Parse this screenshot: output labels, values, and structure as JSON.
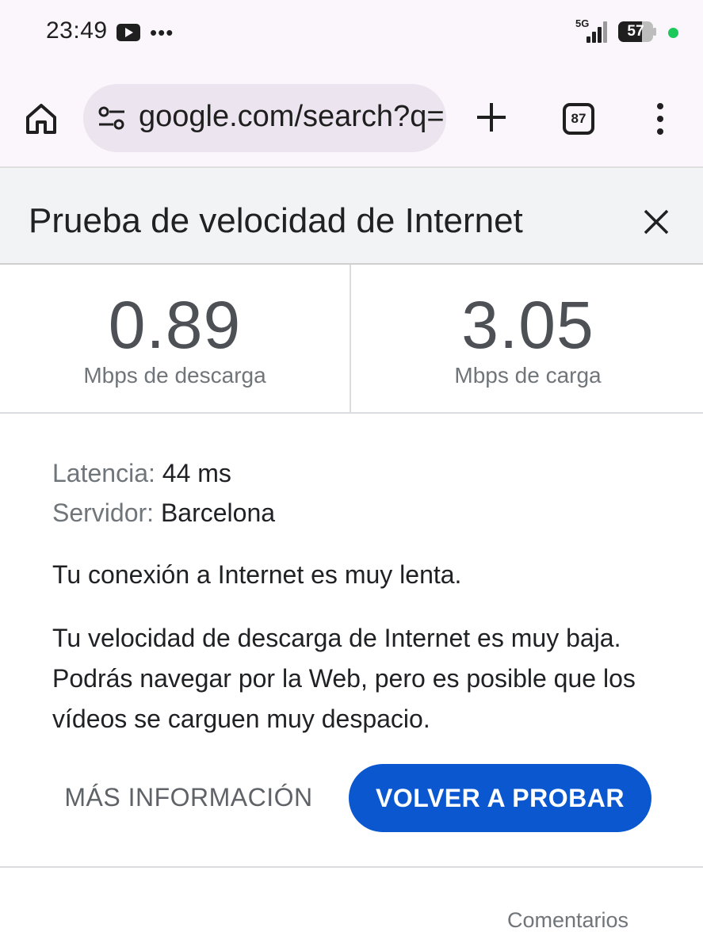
{
  "status_bar": {
    "time": "23:49",
    "network": "5G",
    "battery": "57",
    "icons": [
      "youtube-icon",
      "more-dots-icon",
      "signal-icon",
      "battery-icon",
      "privacy-dot-icon"
    ]
  },
  "browser": {
    "url": "google.com/search?q=",
    "tab_count": "87",
    "icons": [
      "home-icon",
      "site-settings-icon",
      "new-tab-plus-icon",
      "tab-switcher-icon",
      "menu-kebab-icon"
    ]
  },
  "speed_test": {
    "title": "Prueba de velocidad de Internet",
    "download": {
      "value": "0.89",
      "unit": "Mbps de descarga"
    },
    "upload": {
      "value": "3.05",
      "unit": "Mbps de carga"
    },
    "latency": {
      "label": "Latencia:",
      "value": "44 ms"
    },
    "server": {
      "label": "Servidor:",
      "value": "Barcelona"
    },
    "message": "Tu conexión a Internet es muy lenta.",
    "description": "Tu velocidad de descarga de Internet es muy baja. Podrás navegar por la Web, pero es posible que los vídeos se carguen muy despacio.",
    "more_info_label": "MÁS INFORMACIÓN",
    "retry_label": "VOLVER A PROBAR",
    "feedback_label": "Comentarios"
  },
  "colors": {
    "accent": "#0b57d0",
    "status_dot": "#1fc85a"
  }
}
